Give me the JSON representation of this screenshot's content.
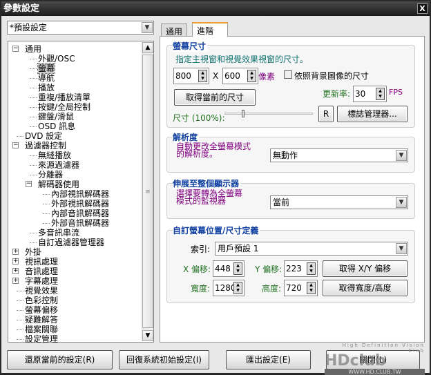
{
  "window": {
    "title": "參數設定",
    "close": "X"
  },
  "preset": {
    "value": "*預設設定"
  },
  "tree": [
    {
      "label": "通用",
      "toggle": "−"
    },
    {
      "label": "外觀/OSC"
    },
    {
      "label": "螢幕",
      "selected": true
    },
    {
      "label": "導航"
    },
    {
      "label": "播放"
    },
    {
      "label": "重複/播放清單"
    },
    {
      "label": "按鍵/全局控制"
    },
    {
      "label": "鍵盤/滑鼠"
    },
    {
      "label": "OSD 訊息"
    },
    {
      "label": "DVD 設定"
    },
    {
      "label": "過濾器控制",
      "toggle": "−"
    },
    {
      "label": "無縫播放"
    },
    {
      "label": "來源過濾器"
    },
    {
      "label": "分離器"
    },
    {
      "label": "解碼器使用",
      "toggle": "−"
    },
    {
      "label": "內部視訊解碼器"
    },
    {
      "label": "外部視訊解碼器"
    },
    {
      "label": "內部音訊解碼器"
    },
    {
      "label": "外部音訊解碼器"
    },
    {
      "label": "多音訊串流"
    },
    {
      "label": "自訂過濾器管理器"
    },
    {
      "label": "外掛",
      "toggle": "+"
    },
    {
      "label": "視訊處理",
      "toggle": "+"
    },
    {
      "label": "音訊處理",
      "toggle": "+"
    },
    {
      "label": "字幕處理",
      "toggle": "+"
    },
    {
      "label": "視覺效果"
    },
    {
      "label": "色彩控制"
    },
    {
      "label": "螢幕偏移"
    },
    {
      "label": "疑難解答"
    },
    {
      "label": "檔案關聯"
    },
    {
      "label": "設定管理"
    }
  ],
  "tabs": [
    {
      "label": "通用"
    },
    {
      "label": "進階"
    }
  ],
  "screen_size": {
    "title": "螢幕尺寸",
    "desc": "指定主視窗和視覺效果視窗的尺寸。",
    "width": "800",
    "x": "X",
    "height": "600",
    "unit": "像素",
    "bg_checkbox": "依照背景圖像的尺寸",
    "bg_checked": false,
    "get_current": "取得當前的尺寸",
    "refresh_label": "更新率:",
    "refresh": "30",
    "fps": "FPS",
    "size_label": "尺寸 (100%):",
    "size_percent": 100,
    "r_button": "R",
    "logo_manager": "標誌管理器..."
  },
  "resolution": {
    "title": "解析度",
    "desc1": "自動更改全螢幕模式",
    "desc2": "的解析度。",
    "value": "無動作"
  },
  "stretch": {
    "title": "伸展至整個顯示器",
    "desc1": "選擇要轉為全螢幕",
    "desc2": "模式的監視器",
    "value": "當前"
  },
  "custom": {
    "title": "自訂螢幕位置/尺寸定義",
    "index_label": "索引:",
    "index": "用戶預設 1",
    "xoff_label": "X 偏移:",
    "xoff": "448",
    "yoff_label": "Y 偏移:",
    "yoff": "223",
    "get_xy": "取得 X/Y 偏移",
    "w_label": "寬度:",
    "w": "1280",
    "h_label": "高度:",
    "h": "720",
    "get_wh": "取得寬度/高度"
  },
  "buttons": {
    "restore": "還原當前的設定(R)",
    "reset": "回復系統初始設定(I)",
    "export": "匯出設定(E)",
    "close": "關閉(L)"
  },
  "watermark": {
    "line1": "High Definition Vision Club",
    "logo": "HDclub",
    "line2": "WWW.HD.CLUB.TW"
  }
}
